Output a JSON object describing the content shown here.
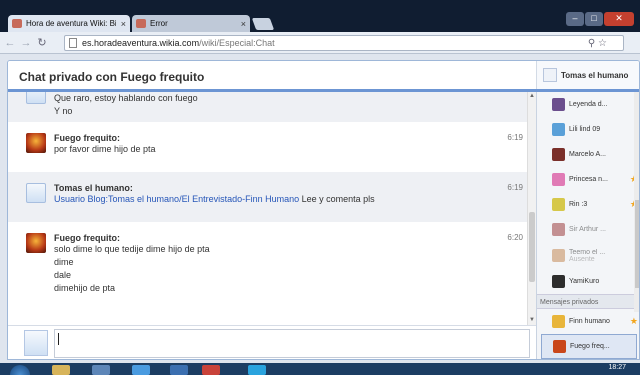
{
  "browser": {
    "tabs": [
      {
        "title": "Hora de aventura Wiki: Bi",
        "active": true
      },
      {
        "title": "Error",
        "active": false
      }
    ],
    "url_host": "es.horadeaventura.wikia.com",
    "url_path": "/wiki/Especial:Chat",
    "back_icon": "back-arrow-icon",
    "forward_icon": "forward-arrow-icon",
    "reload_icon": "reload-icon",
    "close_glyph": "×"
  },
  "chat": {
    "title": "Chat privado con Fuego frequito",
    "header_user": "Tomas el humano",
    "messages": [
      {
        "author": "",
        "time": "",
        "avatar": "finn",
        "alt": true,
        "lines": [
          "Que raro, estoy hablando con fuego",
          "Y no"
        ]
      },
      {
        "author": "Fuego frequito:",
        "time": "6:19",
        "avatar": "fuego",
        "alt": false,
        "lines": [
          "por favor dime hijo de pta"
        ]
      },
      {
        "author": "Tomas el humano:",
        "time": "6:19",
        "avatar": "finn",
        "alt": true,
        "link": "Usuario Blog:Tomas el humano/El Entrevistado-Finn Humano",
        "link_suffix": " Lee y comenta pls"
      },
      {
        "author": "Fuego frequito:",
        "time": "6:20",
        "avatar": "fuego",
        "alt": false,
        "lines": [
          "solo dime lo que tedije dime hijo de pta",
          "dime",
          "dale",
          "dimehijo de pta"
        ]
      }
    ]
  },
  "users": [
    {
      "name": "Leyenda d...",
      "color": "#6b4e8d",
      "star": false
    },
    {
      "name": "Lili lind 09",
      "color": "#5aa0d8",
      "star": false
    },
    {
      "name": "Marcelo A...",
      "color": "#7a2f2a",
      "star": false
    },
    {
      "name": "Princesa n...",
      "color": "#e07ab5",
      "star": true
    },
    {
      "name": "Rin :3",
      "color": "#d6c84a",
      "star": true
    },
    {
      "name": "Sir Arthur ...",
      "color": "#9c3f3f",
      "star": false,
      "away": true
    },
    {
      "name": "Teemo el ...",
      "status": "Ausente",
      "color": "#c48a57",
      "star": false,
      "away": true
    },
    {
      "name": "YamiKuro",
      "color": "#2d2d2d",
      "star": false
    }
  ],
  "private_label": "Mensajes privados",
  "private_users": [
    {
      "name": "Finn humano",
      "color": "#e8b53a",
      "star": true
    },
    {
      "name": "Fuego freq...",
      "color": "#c9471b",
      "star": false,
      "selected": true
    }
  ],
  "taskbar": {
    "clock": "18:27"
  }
}
